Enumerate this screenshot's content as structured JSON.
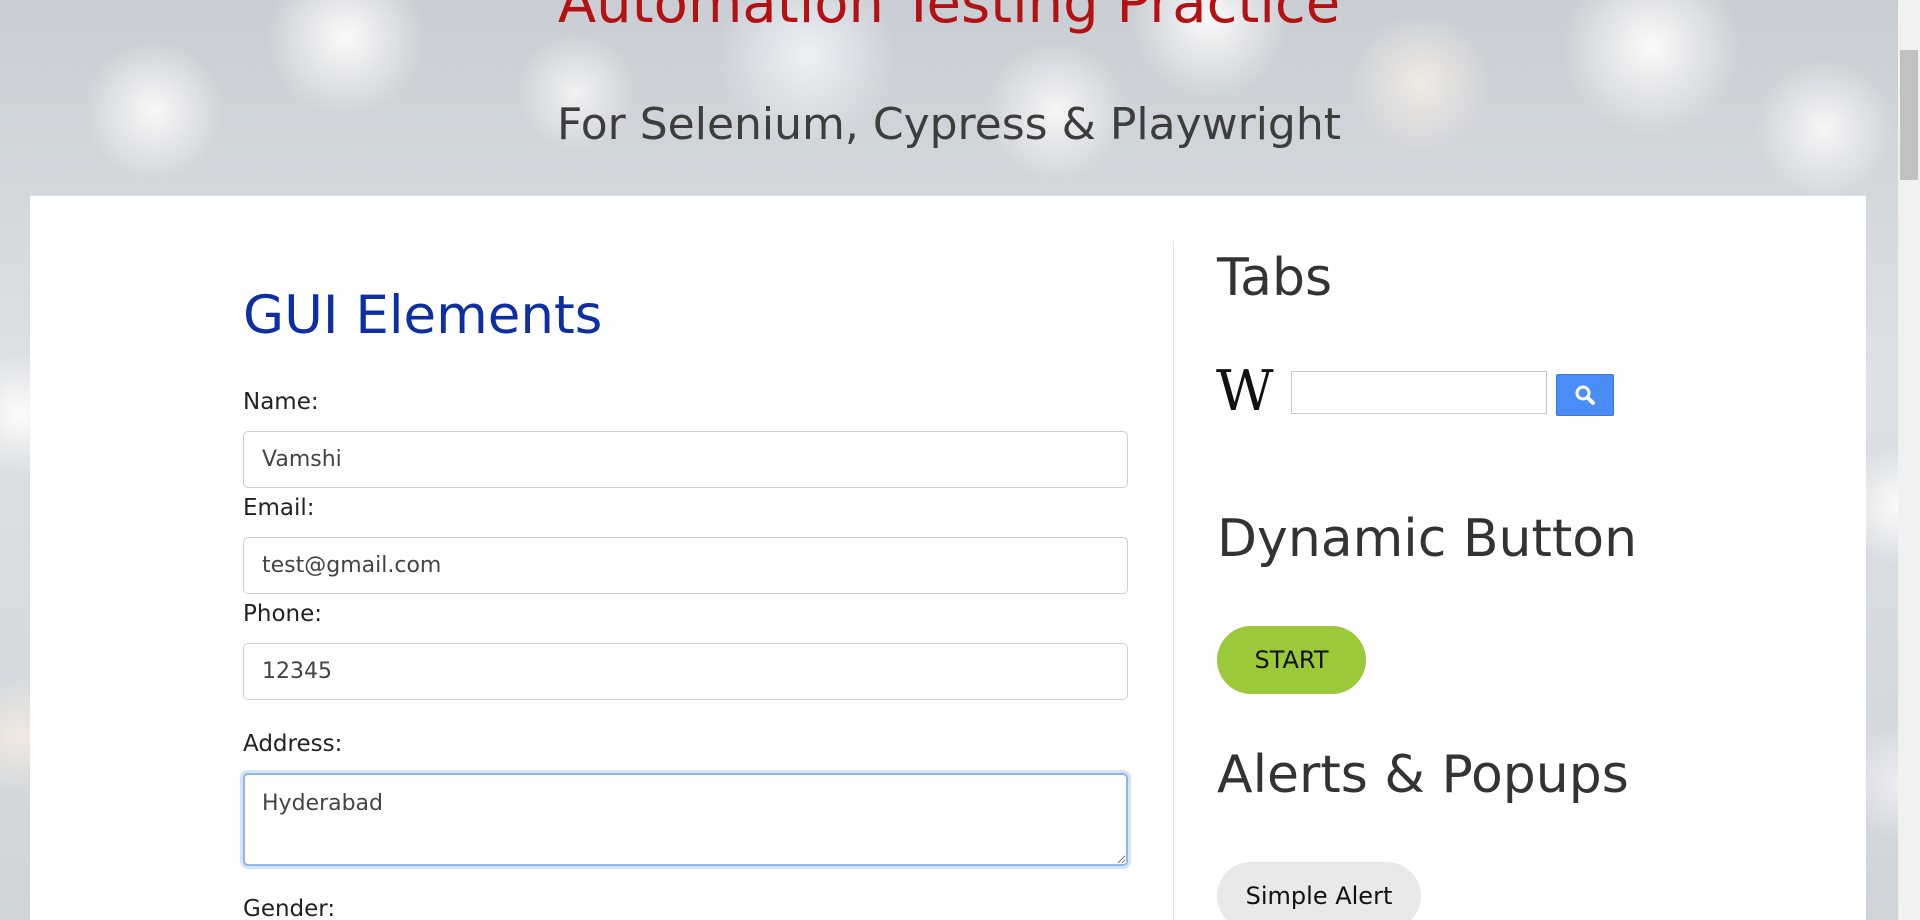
{
  "header": {
    "title": "Automation Testing Practice",
    "subtitle": "For Selenium, Cypress & Playwright"
  },
  "gui_section": {
    "title": "GUI Elements",
    "fields": {
      "name": {
        "label": "Name:",
        "value": "Vamshi"
      },
      "email": {
        "label": "Email:",
        "value": "test@gmail.com"
      },
      "phone": {
        "label": "Phone:",
        "value": "12345"
      },
      "address": {
        "label": "Address:",
        "value": "Hyderabad"
      },
      "gender": {
        "label": "Gender:"
      }
    }
  },
  "tabs_section": {
    "title": "Tabs",
    "wiki_logo": "W",
    "search_icon": "search-icon"
  },
  "dynamic_button_section": {
    "title": "Dynamic Button",
    "button_label": "START"
  },
  "alerts_section": {
    "title": "Alerts & Popups",
    "simple_alert_label": "Simple Alert"
  },
  "colors": {
    "page_title": "#b31212",
    "gui_title": "#0e2fa2",
    "start_button": "#9bc93a",
    "search_button": "#4b8df8"
  }
}
